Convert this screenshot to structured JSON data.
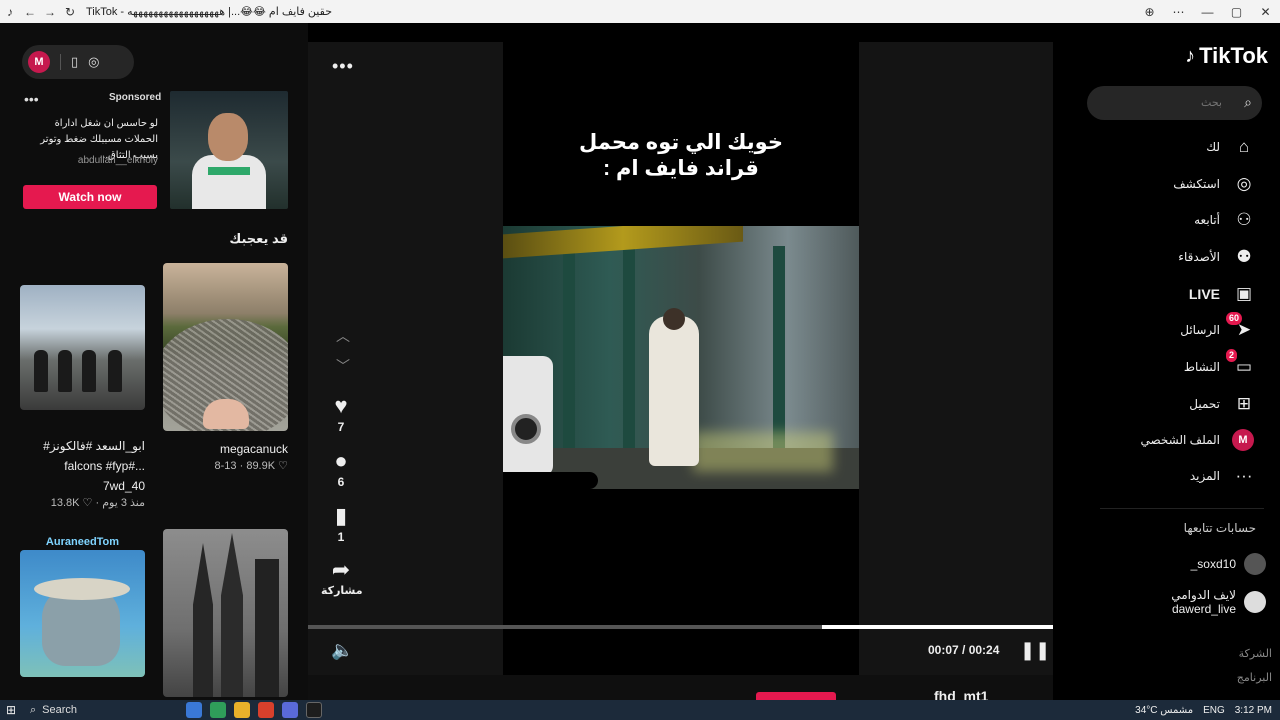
{
  "window": {
    "title": "TikTok - حقين فايف ام 😂😂...| ههههههههههههههههههه",
    "icons": [
      "tiktok-icon",
      "back-icon",
      "forward-icon",
      "reload-icon",
      "zoom-icon",
      "menu-icon",
      "minimize-icon",
      "maximize-icon",
      "close-icon"
    ]
  },
  "top_pill": {
    "avatar_letter": "M"
  },
  "ad": {
    "sponsored": "Sponsored",
    "text": "لو حاسس ان شغل اداراة الحملات مسببلك ضغط وتوتر بسبب التثاق...",
    "user": "abdullah__elkholy",
    "cta": "Watch now"
  },
  "suggestions": {
    "heading": "قد يعجبك",
    "cards": [
      {
        "caption_line1": "#ابو_السعد #فالكونز",
        "caption_line2": "falcons #fyp#...",
        "user": "7wd_40",
        "meta": "13.8K ♡ · منذ 3 يوم"
      },
      {
        "user": "megacanuck",
        "meta": "8-13 · 89.9K ♡"
      },
      {
        "overlay_title": "AuraneedTom"
      },
      {}
    ]
  },
  "video": {
    "overlay_text_line1": "خويك الي توه محمل",
    "overlay_text_line2": "قراند فايف ام :",
    "progress_fraction": 0.31,
    "time": "00:07 / 00:24",
    "next_user": "fhd_mt1"
  },
  "actions": {
    "likes": "7",
    "comments": "6",
    "saves": "1",
    "share_label": "مشاركة"
  },
  "brand": {
    "name": "TikTok"
  },
  "search": {
    "placeholder": "بحث"
  },
  "nav": {
    "for_you": "لك",
    "explore": "استكشف",
    "following": "أتابعه",
    "friends": "الأصدقاء",
    "live": "LIVE",
    "messages": "الرسائل",
    "messages_badge": "60",
    "activity": "النشاط",
    "activity_badge": "2",
    "upload": "تحميل",
    "profile": "الملف الشخصي",
    "profile_letter": "M",
    "more": "المزيد"
  },
  "following_accounts": {
    "heading": "حسابات تتابعها",
    "accounts": [
      {
        "name": "soxd10_"
      },
      {
        "name_line1": "لايف الدوامي",
        "name_line2": "dawerd_live"
      }
    ]
  },
  "footer": {
    "company": "الشركة",
    "program": "البرنامج"
  },
  "taskbar": {
    "search": "Search",
    "weather": "34°C  مشمس",
    "lang": "ENG",
    "time": "3:12 PM"
  },
  "colors": {
    "accent": "#e5194f",
    "avatar": "#c6194e"
  }
}
